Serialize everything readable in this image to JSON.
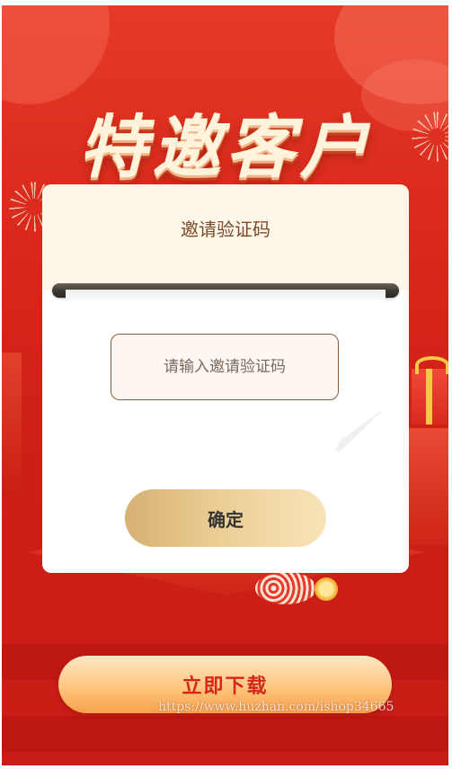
{
  "page": {
    "title": "特邀客户"
  },
  "dialog": {
    "title": "邀请验证码",
    "input_placeholder": "请输入邀请验证码",
    "input_value": "",
    "confirm_label": "确定"
  },
  "footer": {
    "download_label": "立即下载"
  },
  "watermark": {
    "text": "https://www.huzhan.com/ishop34665"
  },
  "colors": {
    "background_red": "#d8261b",
    "dialog_head": "#fdf6e9",
    "title_text": "#7a4a2a",
    "confirm_gold": "#ebcd94",
    "download_orange": "#ffc27a",
    "download_text": "#d5261a"
  }
}
